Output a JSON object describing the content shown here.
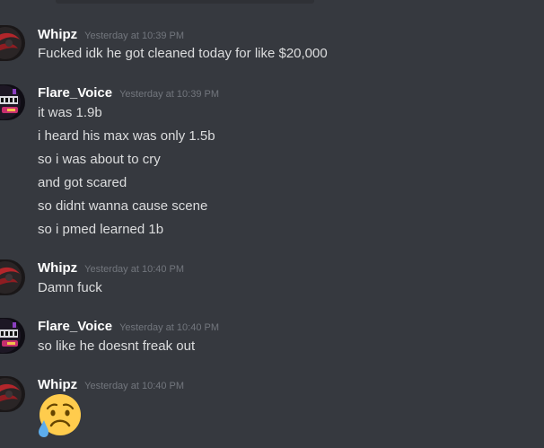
{
  "messages": [
    {
      "author": "Whipz",
      "timestamp": "Yesterday at 10:39 PM",
      "lines": [
        "Fucked idk he got cleaned today for like $20,000"
      ]
    },
    {
      "author": "Flare_Voice",
      "timestamp": "Yesterday at 10:39 PM",
      "lines": [
        "it was 1.9b",
        "i heard his max was only 1.5b",
        "so i was about to cry",
        "and got scared",
        "so didnt wanna cause scene",
        "so i pmed learned 1b"
      ]
    },
    {
      "author": "Whipz",
      "timestamp": "Yesterday at 10:40 PM",
      "lines": [
        "Damn fuck"
      ]
    },
    {
      "author": "Flare_Voice",
      "timestamp": "Yesterday at 10:40 PM",
      "lines": [
        "so like he doesnt freak out"
      ]
    },
    {
      "author": "Whipz",
      "timestamp": "Yesterday at 10:40 PM",
      "lines": [],
      "emoji": "sad-but-relieved-face-emoji"
    }
  ],
  "colors": {
    "background": "#36393f",
    "username": "#ffffff",
    "timestamp": "#72767d",
    "text": "#dcddde"
  }
}
